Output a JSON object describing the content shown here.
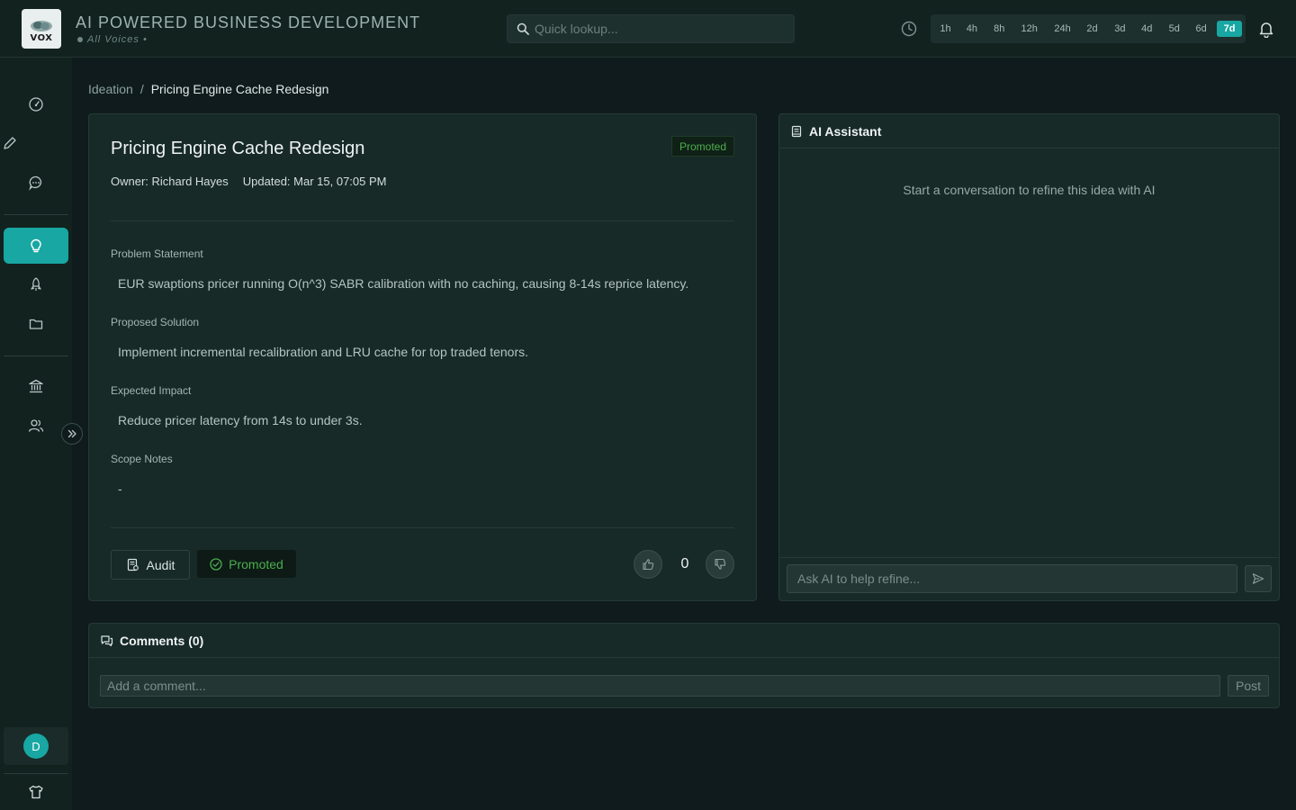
{
  "header": {
    "logo_text": "VOX",
    "title": "AI POWERED BUSINESS DEVELOPMENT",
    "subtitle": "All Voices •",
    "search_placeholder": "Quick lookup...",
    "time_ranges": [
      "1h",
      "4h",
      "8h",
      "12h",
      "24h",
      "2d",
      "3d",
      "4d",
      "5d",
      "6d",
      "7d"
    ],
    "active_range": "7d",
    "icons": [
      "clock-icon",
      "bell-icon",
      "search-icon"
    ]
  },
  "sidebar": {
    "items": [
      {
        "icon": "dashboard-gauge-icon"
      },
      {
        "icon": "pen-icon"
      },
      {
        "icon": "chat-icon"
      },
      {
        "icon": "lightbulb-icon",
        "active": true
      },
      {
        "icon": "rocket-icon"
      },
      {
        "icon": "folder-icon"
      },
      {
        "icon": "bank-icon"
      },
      {
        "icon": "users-icon"
      }
    ],
    "expand_icon": "chevron-double-right-icon",
    "user_initial": "D",
    "bottom_icon": "shirt-icon"
  },
  "breadcrumb": {
    "parent": "Ideation",
    "separator": "/",
    "current": "Pricing Engine Cache Redesign"
  },
  "idea": {
    "title": "Pricing Engine Cache Redesign",
    "status_badge": "Promoted",
    "owner": "Owner: Richard Hayes",
    "updated": "Updated: Mar 15, 07:05 PM",
    "fields": [
      {
        "label": "Problem Statement",
        "value": "EUR swaptions pricer running O(n^3) SABR calibration with no caching, causing 8-14s reprice latency."
      },
      {
        "label": "Proposed Solution",
        "value": "Implement incremental recalibration and LRU cache for top traded tenors."
      },
      {
        "label": "Expected Impact",
        "value": "Reduce pricer latency from 14s to under 3s."
      },
      {
        "label": "Scope Notes",
        "value": "-"
      }
    ],
    "audit_label": "Audit",
    "promoted_label": "Promoted",
    "vote_count": "0"
  },
  "ai_assistant": {
    "title": "AI Assistant",
    "empty_text": "Start a conversation to refine this idea with AI",
    "input_placeholder": "Ask AI to help refine..."
  },
  "comments": {
    "title": "Comments (0)",
    "input_placeholder": "Add a comment...",
    "post_label": "Post"
  },
  "colors": {
    "accent": "#18a7a3",
    "promoted_green": "#4cae4c",
    "background": "#0f1b1d",
    "card": "#172a28"
  }
}
